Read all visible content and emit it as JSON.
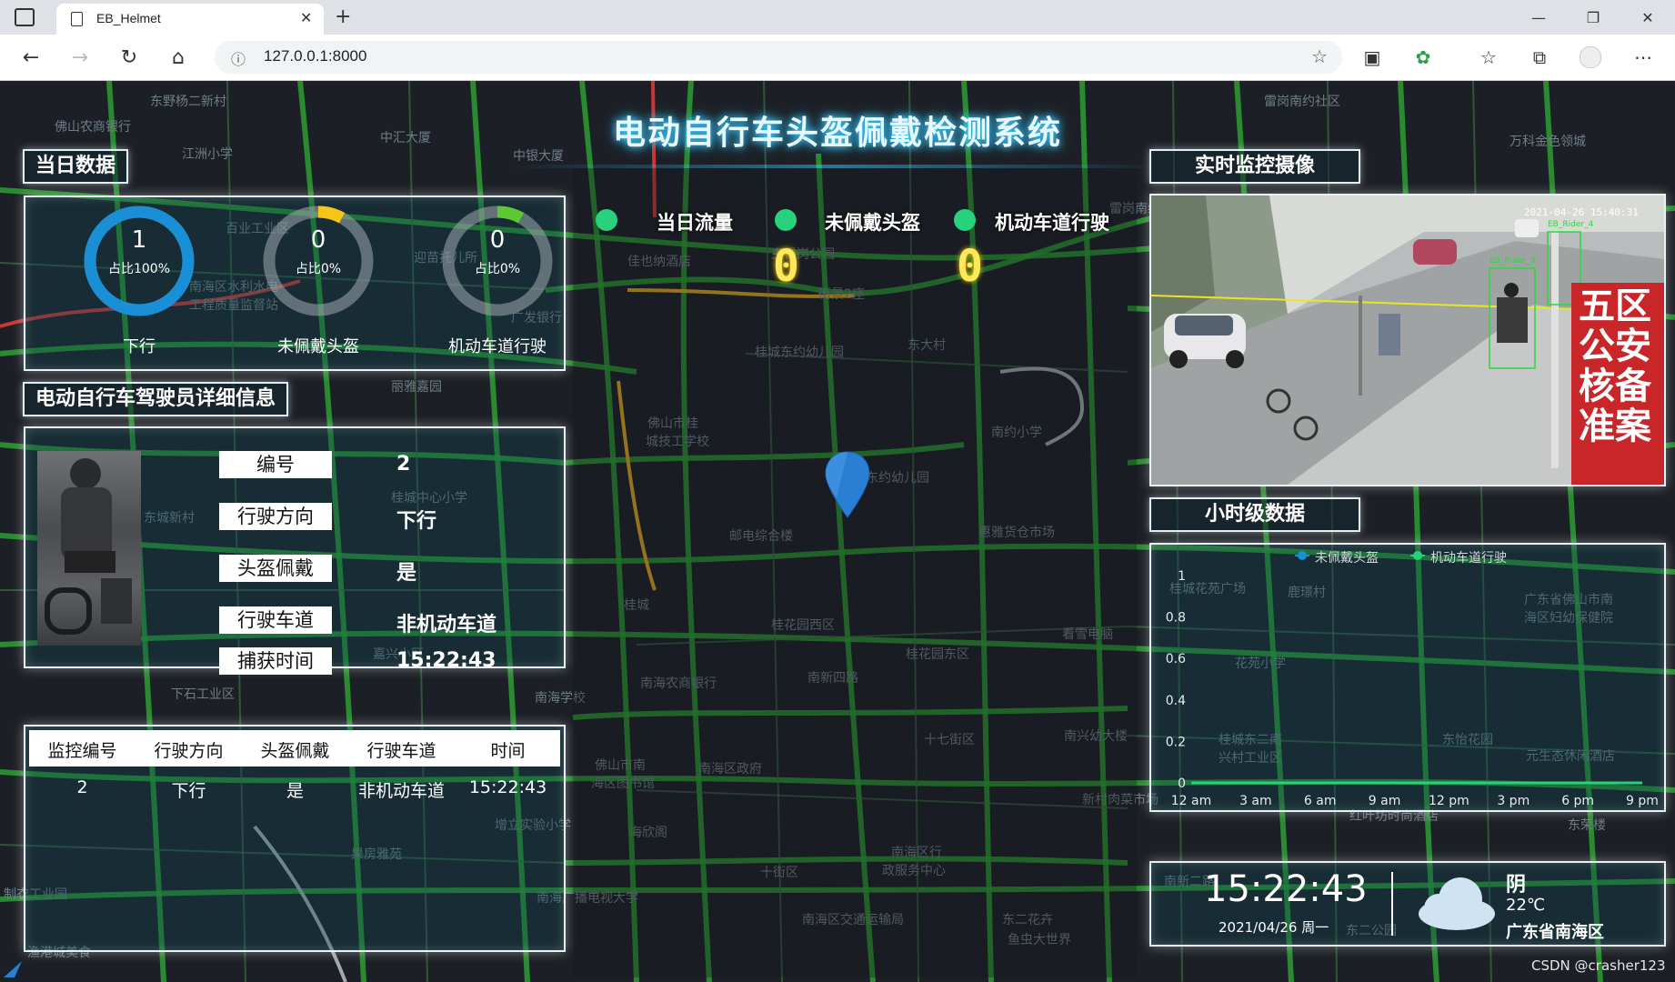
{
  "browser": {
    "tab_title": "EB_Helmet",
    "url": "127.0.0.1:8000"
  },
  "app": {
    "title": "电动自行车头盔佩戴检测系统"
  },
  "daily": {
    "title": "当日数据",
    "rings": [
      {
        "value": "1",
        "pct": "占比100%",
        "label": "下行",
        "fraction": 1.0,
        "color": "#1a8fd6"
      },
      {
        "value": "0",
        "pct": "占比0%",
        "label": "未佩戴头盔",
        "fraction": 0.08,
        "color": "#f5c518"
      },
      {
        "value": "0",
        "pct": "占比0%",
        "label": "机动车道行驶",
        "fraction": 0.08,
        "color": "#5cc933"
      }
    ]
  },
  "counters": [
    {
      "label": "当日流量",
      "value": ""
    },
    {
      "label": "未佩戴头盔",
      "value": "0"
    },
    {
      "label": "机动车道行驶",
      "value": "0"
    }
  ],
  "rider": {
    "title": "电动自行车驾驶员详细信息",
    "fields": [
      {
        "label": "编号",
        "value": "2"
      },
      {
        "label": "行驶方向",
        "value": "下行"
      },
      {
        "label": "头盔佩戴",
        "value": "是"
      },
      {
        "label": "行驶车道",
        "value": "非机动车道"
      },
      {
        "label": "捕获时间",
        "value": "15:22:43"
      }
    ]
  },
  "table": {
    "headers": [
      "监控编号",
      "行驶方向",
      "头盔佩戴",
      "行驶车道",
      "时间"
    ],
    "rows": [
      [
        "2",
        "下行",
        "是",
        "非机动车道",
        "15:22:43"
      ]
    ]
  },
  "camera": {
    "title": "实时监控摄像",
    "timestamp": "2021-04-26 15:40:31",
    "det_labels": [
      "EB_Rider_3",
      "EB_Rider_4"
    ],
    "sign": "五区公安核备准案"
  },
  "hourly": {
    "title": "小时级数据"
  },
  "chart_data": {
    "type": "line",
    "series": [
      {
        "name": "未佩戴头盔",
        "values": [
          0,
          0,
          0,
          0,
          0,
          0,
          0,
          0
        ],
        "color": "#1a8fd6"
      },
      {
        "name": "机动车道行驶",
        "values": [
          0,
          0,
          0,
          0,
          0,
          0,
          0,
          0
        ],
        "color": "#28d17c"
      }
    ],
    "categories": [
      "12 am",
      "3 am",
      "6 am",
      "9 am",
      "12 pm",
      "3 pm",
      "6 pm",
      "9 pm"
    ],
    "yticks": [
      "0",
      "0.2",
      "0.4",
      "0.6",
      "0.8",
      "1"
    ],
    "ylim": [
      0,
      1
    ],
    "legend": "top"
  },
  "clock": {
    "time": "15:22:43",
    "date": "2021/04/26 周一"
  },
  "weather": {
    "condition": "阴",
    "temp": "22℃",
    "location": "广东省南海区"
  },
  "watermark": "CSDN @crasher123",
  "map_labels": [
    {
      "t": "东野杨二新村"
    },
    {
      "t": "佛山农商银行"
    },
    {
      "t": "江洲小学"
    },
    {
      "t": "中汇大厦"
    },
    {
      "t": "中银大厦"
    },
    {
      "t": "雷岗南约社区"
    },
    {
      "t": "万科金色领城"
    },
    {
      "t": "百业工业区"
    },
    {
      "t": "迎苗托儿所"
    },
    {
      "t": "南海区水利水电"
    },
    {
      "t": "工程质量监督站"
    },
    {
      "t": "广发银行"
    },
    {
      "t": "丽雅嘉园"
    },
    {
      "t": "桂城中心小学"
    },
    {
      "t": "东城新村"
    },
    {
      "t": "嘉兴小区"
    },
    {
      "t": "下石工业区"
    },
    {
      "t": "果房雅苑"
    },
    {
      "t": "制衣工业园"
    },
    {
      "t": "渔港城美食"
    },
    {
      "t": "佳也纳酒店"
    },
    {
      "t": "虫雷岗公园"
    },
    {
      "t": "街景2座"
    },
    {
      "t": "桂城东约幼儿园"
    },
    {
      "t": "东大村"
    },
    {
      "t": "佛山市桂"
    },
    {
      "t": "城技工学校"
    },
    {
      "t": "南约小学"
    },
    {
      "t": "东约幼儿园"
    },
    {
      "t": "邮电综合楼"
    },
    {
      "t": "惠雅货仓市场"
    },
    {
      "t": "桂城"
    },
    {
      "t": "桂花园西区"
    },
    {
      "t": "桂花园东区"
    },
    {
      "t": "看雪电脑"
    },
    {
      "t": "南海农商银行"
    },
    {
      "t": "南新四路"
    },
    {
      "t": "南海学校"
    },
    {
      "t": "十七街区"
    },
    {
      "t": "南兴幼大楼"
    },
    {
      "t": "佛山市南"
    },
    {
      "t": "海区图书馆"
    },
    {
      "t": "南海区政府"
    },
    {
      "t": "海欣阁"
    },
    {
      "t": "南海区行"
    },
    {
      "t": "政服务中心"
    },
    {
      "t": "十街区"
    },
    {
      "t": "南海广播电视大学"
    },
    {
      "t": "南海区交通运输局"
    },
    {
      "t": "东二花卉"
    },
    {
      "t": "鱼虫大世界"
    },
    {
      "t": "新村肉菜市场"
    },
    {
      "t": "桂城花苑广场"
    },
    {
      "t": "鹿璟村"
    },
    {
      "t": "广东省佛山市南"
    },
    {
      "t": "海区妇幼保健院"
    },
    {
      "t": "花苑小学"
    },
    {
      "t": "桂城东二南"
    },
    {
      "t": "兴村工业区"
    },
    {
      "t": "东怡花园"
    },
    {
      "t": "元生态休闲酒店"
    },
    {
      "t": "红叶坊时尚酒店"
    },
    {
      "t": "东荣楼"
    },
    {
      "t": "东二公园"
    },
    {
      "t": "南新二路"
    },
    {
      "t": "增立实验小学"
    },
    {
      "t": "雷岗南约市场"
    }
  ]
}
